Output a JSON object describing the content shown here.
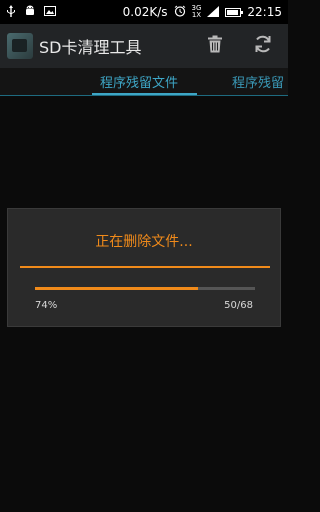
{
  "status_bar": {
    "icons": [
      "usb-icon",
      "android-debug-icon",
      "image-notification-icon"
    ],
    "speed": "0.02K/s",
    "network_top": "3G",
    "network_bottom": "1X",
    "time": "22:15",
    "battery_level": 0.9
  },
  "action_bar": {
    "title": "SD卡清理工具",
    "actions": [
      "trash-icon",
      "refresh-icon"
    ]
  },
  "tabs": [
    {
      "label": "程序残留文件",
      "active": true
    },
    {
      "label": "程序残留",
      "active": false
    }
  ],
  "dialog": {
    "title": "正在删除文件...",
    "progress_percent_text": "74%",
    "progress_count_text": "50/68",
    "progress_fraction": 0.74
  },
  "colors": {
    "accent_orange": "#f08a1a",
    "tab_blue": "#3ea6c6",
    "action_bar_bg": "#222426",
    "background": "#0b0b0b"
  }
}
